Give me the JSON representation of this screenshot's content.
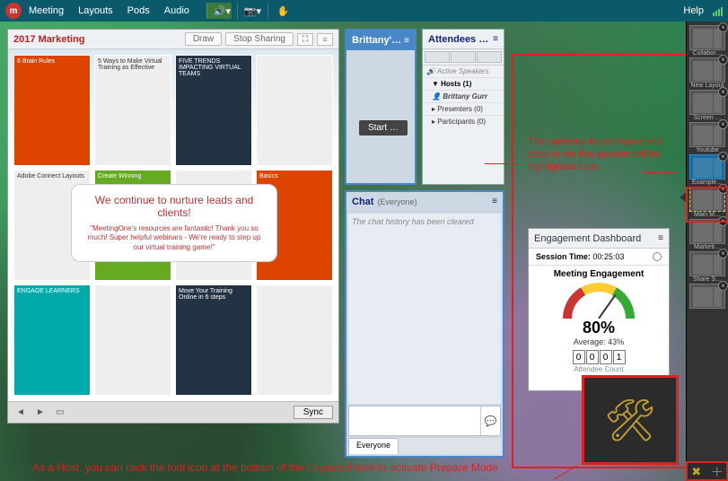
{
  "menubar": {
    "items": [
      "Meeting",
      "Layouts",
      "Pods",
      "Audio"
    ],
    "help": "Help"
  },
  "share": {
    "title": "2017 Marketing",
    "draw": "Draw",
    "stop": "Stop Sharing",
    "bubble_h": "We continue to nurture leads and clients!",
    "bubble_p": "\"MeetingOne's resources are fantastic! Thank you so much! Super helpful webinars - We're ready to step up our virtual training game!\"",
    "tiles": [
      "6 Brain Rules",
      "5 Ways to Make Virtual Training as Effective",
      "FIVE TRENDS IMPACTING VIRTUAL TEAMS",
      "Adobe Connect Layouts",
      "Create Winning",
      "ENGAGE LEARNERS",
      "Move Your Training Online in 6 steps",
      "Basics"
    ],
    "sync": "Sync"
  },
  "poll": {
    "title": "Brittany'…",
    "start": "Start …"
  },
  "attendees": {
    "title": "Attendees …",
    "active": "Active Speakers",
    "hosts": "Hosts (1)",
    "host1": "Brittany Gurr",
    "presenters": "Presenters (0)",
    "participants": "Participants (0)"
  },
  "chat": {
    "title": "Chat",
    "scope": "(Everyone)",
    "cleared": "The chat history has been cleared",
    "tab": "Everyone"
  },
  "engagement": {
    "title": "Engagement Dashboard",
    "session_label": "Session Time:",
    "session_time": "00:25:03",
    "heading": "Meeting Engagement",
    "percent": "80%",
    "average": "Average: 43%",
    "counter": [
      "0",
      "0",
      "0",
      "1"
    ],
    "attendee_count": "Attendee Count"
  },
  "annotations": {
    "top": "The currently in use layout and pods in the live session will be highlighted blue.",
    "bottom": "As a Host, you can click the tool icon at the bottom of the Layouts Panel to activate Prepare Mode"
  },
  "layouts": {
    "items": [
      {
        "label": "Collabor…",
        "active": false,
        "dash": false
      },
      {
        "label": "New Layout",
        "active": false,
        "dash": false
      },
      {
        "label": "Screen …",
        "active": false,
        "dash": false
      },
      {
        "label": "Youtube",
        "active": false,
        "dash": false
      },
      {
        "label": "Example…",
        "active": true,
        "dash": false
      },
      {
        "label": "Main M…",
        "active": false,
        "dash": true
      },
      {
        "label": "Marketi…",
        "active": false,
        "dash": false
      },
      {
        "label": "Share S…",
        "active": false,
        "dash": false
      },
      {
        "label": "",
        "active": false,
        "dash": false
      }
    ]
  }
}
